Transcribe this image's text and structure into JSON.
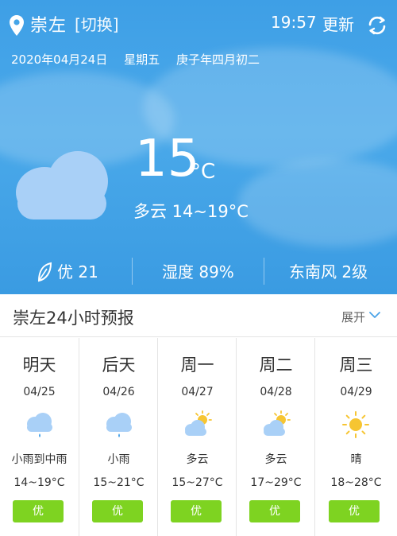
{
  "header": {
    "city": "崇左",
    "switch_label": "[切换]",
    "time": "19:57",
    "refresh_label": "更新",
    "date": "2020年04月24日",
    "weekday": "星期五",
    "lunar_date": "庚子年四月初二"
  },
  "current": {
    "temperature": "15",
    "unit": "°C",
    "condition": "多云 14~19°C",
    "icon": "cloud-moon-icon",
    "air_quality": "优 21",
    "humidity": "湿度 89%",
    "wind": "东南风 2级"
  },
  "forecast": {
    "title": "崇左24小时预报",
    "expand_label": "展开",
    "aqi_color": "#7ed321",
    "days": [
      {
        "name": "明天",
        "date": "04/25",
        "icon": "rain-cloud-icon",
        "condition": "小雨到中雨",
        "temp": "14~19°C",
        "aqi": "优"
      },
      {
        "name": "后天",
        "date": "04/26",
        "icon": "rain-cloud-icon",
        "condition": "小雨",
        "temp": "15~21°C",
        "aqi": "优"
      },
      {
        "name": "周一",
        "date": "04/27",
        "icon": "partly-cloudy-icon",
        "condition": "多云",
        "temp": "15~27°C",
        "aqi": "优"
      },
      {
        "name": "周二",
        "date": "04/28",
        "icon": "partly-cloudy-icon",
        "condition": "多云",
        "temp": "17~29°C",
        "aqi": "优"
      },
      {
        "name": "周三",
        "date": "04/29",
        "icon": "sun-icon",
        "condition": "晴",
        "temp": "18~28°C",
        "aqi": "优"
      }
    ]
  }
}
